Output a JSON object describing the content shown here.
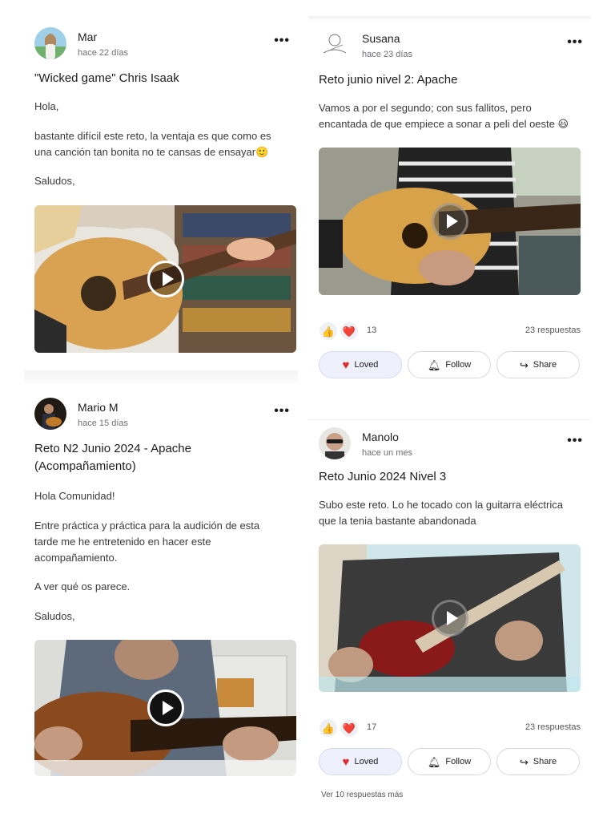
{
  "colors": {
    "accent_heart": "#e0282e",
    "loved_bg": "#eef1fb",
    "text_secondary": "#6e6e73"
  },
  "posts": [
    {
      "author": "Mar",
      "time": "hace 22 días",
      "title": "\"Wicked game\" Chris Isaak",
      "paragraphs": [
        "Hola,",
        "bastante difícil este reto, la ventaja es que como es una canción tan bonita no te cansas de ensayar🙂",
        "Saludos,"
      ],
      "more_icon": "more-dots-icon"
    },
    {
      "author": "Susana",
      "time": "hace 23 días",
      "title": "Reto junio nivel 2: Apache",
      "paragraphs": [
        "Vamos a por el segundo; con sus fallitos, pero encantada de que empiece a sonar a peli del oeste 😃"
      ],
      "reactions": [
        "👍",
        "❤️"
      ],
      "reaction_count": "13",
      "replies": "23 respuestas",
      "actions": {
        "loved": "Loved",
        "follow": "Follow",
        "share": "Share"
      }
    },
    {
      "author": "Mario M",
      "time": "hace 15 días",
      "title": "Reto N2 Junio 2024 - Apache (Acompañamiento)",
      "paragraphs": [
        "Hola Comunidad!",
        "Entre práctica y práctica para la audición de esta tarde me he entretenido en hacer este acompañamiento.",
        "A ver qué os parece.",
        "Saludos,"
      ]
    },
    {
      "author": "Manolo",
      "time": "hace un mes",
      "title": "Reto Junio 2024 Nivel 3",
      "paragraphs": [
        "Subo este reto. Lo he tocado con la guitarra eléctrica que la tenia bastante abandonada"
      ],
      "reactions": [
        "👍",
        "❤️"
      ],
      "reaction_count": "17",
      "replies": "23 respuestas",
      "actions": {
        "loved": "Loved",
        "follow": "Follow",
        "share": "Share"
      },
      "more_replies": "Ver 10 respuestas más"
    }
  ]
}
